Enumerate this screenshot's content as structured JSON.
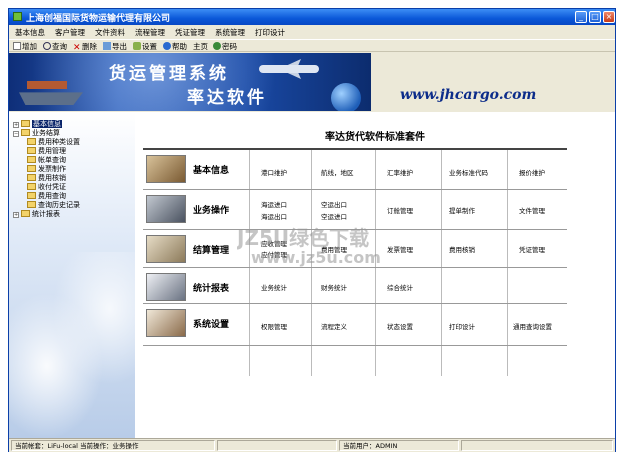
{
  "window": {
    "title": "上海创福国际货物运输代理有限公司",
    "controls": [
      "_",
      "□",
      "×"
    ]
  },
  "menu": [
    "基本信息",
    "客户管理",
    "文件资料",
    "流程管理",
    "凭证管理",
    "系统管理",
    "打印设计"
  ],
  "toolbar": [
    {
      "label": "增加",
      "icon": "add-icon"
    },
    {
      "label": "查询",
      "icon": "search-icon"
    },
    {
      "label": "删除",
      "icon": "delete-icon"
    },
    {
      "label": "导出",
      "icon": "export-icon"
    },
    {
      "label": "设置",
      "icon": "settings-icon"
    },
    {
      "label": "帮助",
      "icon": "help-icon"
    },
    {
      "label": "主页",
      "icon": "home-icon"
    },
    {
      "label": "密码",
      "icon": "password-icon"
    }
  ],
  "banner": {
    "title_line1": "货运管理系统",
    "title_line2": "率达软件",
    "website": "www.jhcargo.com"
  },
  "tree": [
    {
      "label": "基本信息",
      "level": 0,
      "expanded": false,
      "selected": true
    },
    {
      "label": "业务结算",
      "level": 0,
      "expanded": true,
      "selected": false
    },
    {
      "label": "费用种类设置",
      "level": 1
    },
    {
      "label": "费用管理",
      "level": 1
    },
    {
      "label": "帐单查询",
      "level": 1
    },
    {
      "label": "发票制作",
      "level": 1
    },
    {
      "label": "费用核销",
      "level": 1
    },
    {
      "label": "收付凭证",
      "level": 1
    },
    {
      "label": "费用查询",
      "level": 1
    },
    {
      "label": "查询历史记录",
      "level": 1
    },
    {
      "label": "统计报表",
      "level": 0,
      "expanded": false,
      "selected": false
    }
  ],
  "main": {
    "title": "率达货代软件标准套件",
    "rows": [
      {
        "category": "基本信息",
        "cells": [
          [
            "港口维护"
          ],
          [
            "航线，地区"
          ],
          [
            "汇率维护"
          ],
          [
            "业务标准代码"
          ],
          [
            "报价维护"
          ]
        ]
      },
      {
        "category": "业务操作",
        "cells": [
          [
            "海运进口",
            "海运出口"
          ],
          [
            "空运出口",
            "空运进口"
          ],
          [
            "订舱管理"
          ],
          [
            "提单制作"
          ],
          [
            "文件管理"
          ]
        ]
      },
      {
        "category": "结算管理",
        "cells": [
          [
            "应收管理",
            "应付管理"
          ],
          [
            "费用管理"
          ],
          [
            "发票管理"
          ],
          [
            "费用核销"
          ],
          [
            "凭证管理"
          ]
        ]
      },
      {
        "category": "统计报表",
        "cells": [
          [
            "业务统计"
          ],
          [
            "财务统计"
          ],
          [
            "综合统计"
          ],
          [],
          []
        ]
      },
      {
        "category": "系统设置",
        "cells": [
          [
            "权限管理"
          ],
          [
            "流程定义"
          ],
          [
            "状态设置"
          ],
          [
            "打印设计"
          ],
          [
            "通用查询设置"
          ]
        ]
      }
    ]
  },
  "status": {
    "account": "当前帐套：LiFu-local",
    "operation": "当前操作：业务操作",
    "user": "当前用户：ADMIN"
  },
  "watermark": {
    "line1": "JZ5U绿色下载",
    "line2": "www.jz5u.com"
  },
  "colors": {
    "title_bar": "#0a57d8",
    "banner": "#1a4aa6",
    "website_text": "#0c2c8a",
    "selected_node": "#0a246a"
  }
}
